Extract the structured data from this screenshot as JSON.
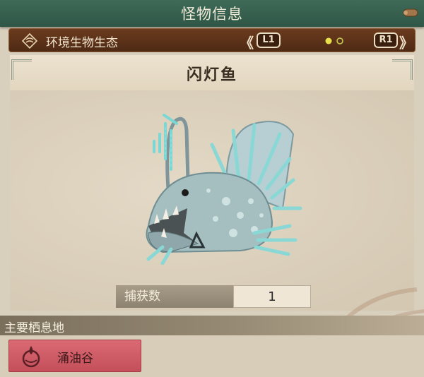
{
  "topbar": {
    "title": "怪物信息"
  },
  "subbar": {
    "category": "环境生物生态",
    "prev_arrow": "《",
    "next_arrow": "》",
    "left_button": "L1",
    "right_button": "R1"
  },
  "monster": {
    "name": "闪灯鱼"
  },
  "capture": {
    "label": "捕获数",
    "value": "1"
  },
  "habitat": {
    "header": "主要栖息地",
    "locations": [
      "涌油谷"
    ]
  },
  "colors": {
    "topbar": "#2f5646",
    "subbar": "#5a3119",
    "habitat_item": "#cf5c67",
    "background": "#d9cfbd"
  }
}
